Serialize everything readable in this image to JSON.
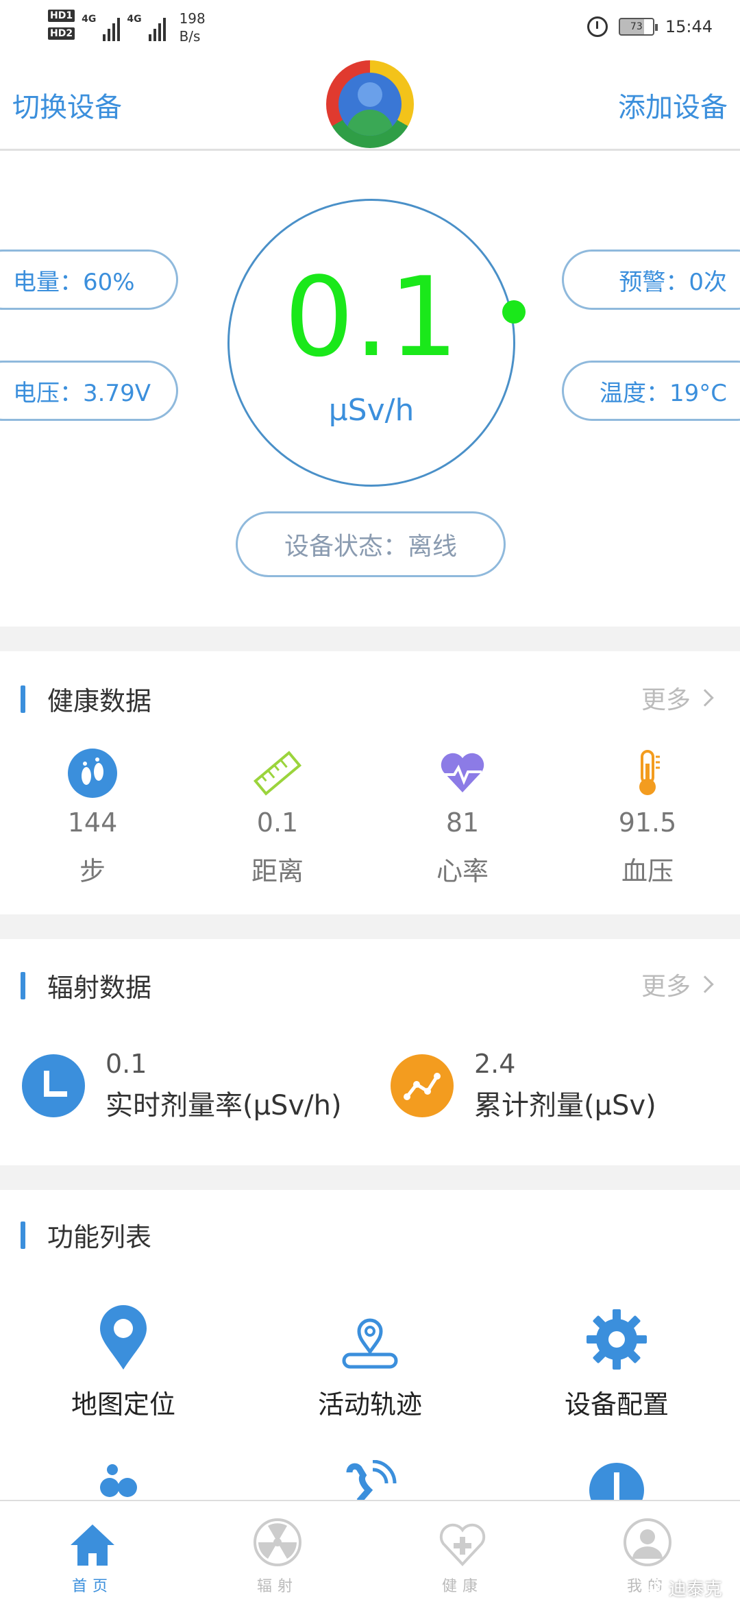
{
  "status_bar": {
    "hd1": "HD1",
    "hd2": "HD2",
    "net1": "4G",
    "net2": "4G",
    "speed_value": "198",
    "speed_unit": "B/s",
    "battery": "73",
    "time": "15:44"
  },
  "header": {
    "switch_device": "切换设备",
    "add_device": "添加设备"
  },
  "gauge": {
    "value": "0.1",
    "unit": "μSv/h",
    "battery_pill": "电量：60%",
    "voltage_pill": "电压：3.79V",
    "warning_pill": "预警：0次",
    "temp_pill": "温度：19°C",
    "device_status": "设备状态：离线"
  },
  "health": {
    "title": "健康数据",
    "more": "更多",
    "items": [
      {
        "value": "144",
        "label": "步",
        "icon": "footprints-icon"
      },
      {
        "value": "0.1",
        "label": "距离",
        "icon": "ruler-icon"
      },
      {
        "value": "81",
        "label": "心率",
        "icon": "heart-pulse-icon"
      },
      {
        "value": "91.5",
        "label": "血压",
        "icon": "thermometer-icon"
      }
    ]
  },
  "radiation": {
    "title": "辐射数据",
    "more": "更多",
    "items": [
      {
        "value": "0.1",
        "label": "实时剂量率(μSv/h)",
        "icon": "clock-icon",
        "color": "#3b8fdc"
      },
      {
        "value": "2.4",
        "label": "累计剂量(μSv)",
        "icon": "trend-icon",
        "color": "#f39c1f"
      }
    ]
  },
  "functions": {
    "title": "功能列表",
    "items": [
      {
        "label": "地图定位",
        "icon": "map-pin-icon"
      },
      {
        "label": "活动轨迹",
        "icon": "track-icon"
      },
      {
        "label": "设备配置",
        "icon": "gear-icon"
      }
    ]
  },
  "tabs": [
    {
      "label": "首页",
      "icon": "home-icon",
      "active": true
    },
    {
      "label": "辐射",
      "icon": "radiation-icon",
      "active": false
    },
    {
      "label": "健康",
      "icon": "health-icon",
      "active": false
    },
    {
      "label": "我的",
      "icon": "user-icon",
      "active": false
    }
  ],
  "watermark": "迪泰克",
  "colors": {
    "accent": "#3b8fdc",
    "reading": "#1ae81a",
    "orange": "#f39c1f"
  }
}
